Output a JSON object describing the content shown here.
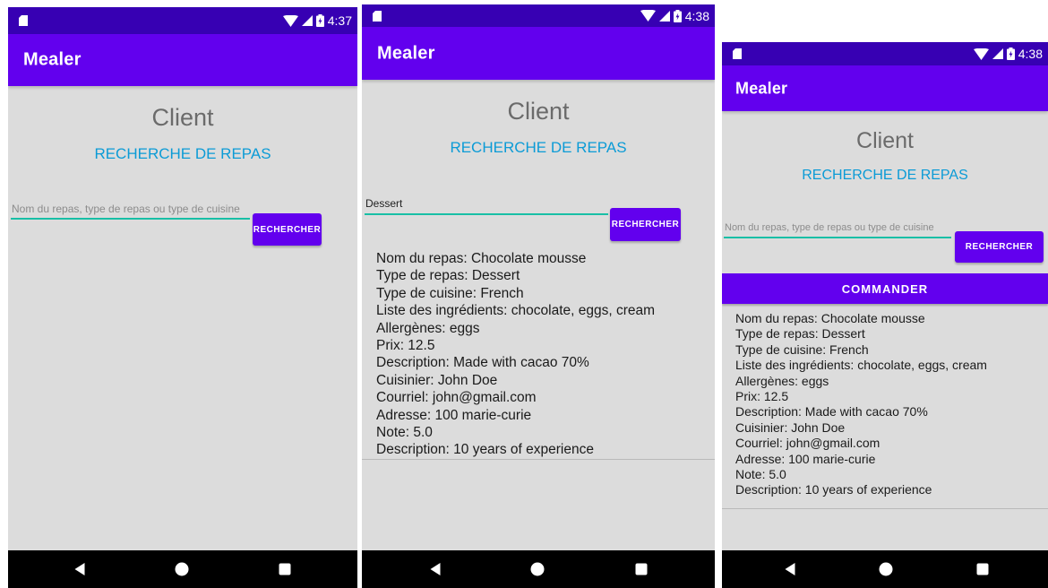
{
  "status_bar": {
    "phone1_time": "4:37",
    "phone2_time": "4:38",
    "phone3_time": "4:38"
  },
  "app": {
    "title": "Mealer"
  },
  "screen": {
    "title": "Client",
    "subtitle": "RECHERCHE DE REPAS"
  },
  "search": {
    "placeholder": "Nom du repas, type de repas ou type de cuisine",
    "query": "Dessert",
    "button_label": "RECHERCHER"
  },
  "order": {
    "button_label": "COMMANDER"
  },
  "result": {
    "lines": [
      "Nom du repas: Chocolate mousse",
      "Type de repas: Dessert",
      "Type de cuisine: French",
      "Liste des ingrédients: chocolate, eggs, cream",
      "Allergènes: eggs",
      "Prix: 12.5",
      "Description: Made with cacao 70%",
      "Cuisinier: John Doe",
      "Courriel: john@gmail.com",
      "Adresse: 100 marie-curie",
      "Note: 5.0",
      "Description: 10 years of experience"
    ]
  },
  "icons": {
    "sim": "sim-card-icon",
    "wifi": "wifi-icon",
    "signal": "cell-signal-icon",
    "battery": "battery-charging-icon",
    "back": "back-triangle-icon",
    "home": "home-circle-icon",
    "recent": "recent-square-icon"
  },
  "colors": {
    "primary": "#6200ee",
    "primary_dark": "#3700b3",
    "accent_teal": "#18bfa6",
    "subtitle_blue": "#0b9bd6",
    "background": "#dcdcdc"
  }
}
